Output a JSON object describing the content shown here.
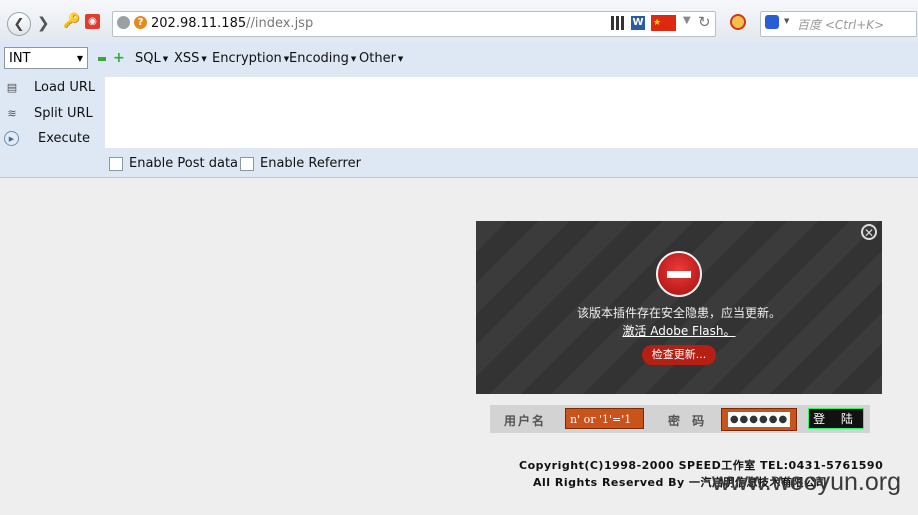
{
  "browser": {
    "url_host": "202.98.11.185",
    "url_path": "//index.jsp",
    "search_engine": "百度",
    "search_placeholder": "百度 <Ctrl+K>",
    "icons": [
      "back-icon",
      "forward-icon",
      "key-icon",
      "shield-icon",
      "site-identity-icon",
      "info-icon",
      "qr-icon",
      "word-icon",
      "china-flag-icon",
      "dropdown-icon",
      "reload-icon",
      "blocked-icon",
      "search-engine-icon"
    ]
  },
  "hackbar": {
    "select_value": "INT",
    "menus": [
      {
        "label": "SQL"
      },
      {
        "label": "XSS"
      },
      {
        "label": "Encryption"
      },
      {
        "label": "Encoding"
      },
      {
        "label": "Other"
      }
    ],
    "load_url": "Load URL",
    "split_url": "Split URL",
    "execute": "Execute",
    "enable_post": "Enable Post data",
    "enable_referrer": "Enable Referrer"
  },
  "flash": {
    "message": "该版本插件存在安全隐患，应当更新。",
    "link": "激活 Adobe Flash。",
    "button": "检查更新..."
  },
  "login": {
    "username_label": "用户名",
    "username_value": "n' or '1'='1",
    "password_label": "密 码",
    "password_mask": "●●●●●●",
    "submit": "登 陆"
  },
  "footer": {
    "copyright": "Copyright(C)1998-2000 SPEED工作室  TEL:0431-5761590",
    "rights": "All Rights Reserved By 一汽启明信息技术有限公司"
  },
  "watermark": "www.wooyun.org"
}
